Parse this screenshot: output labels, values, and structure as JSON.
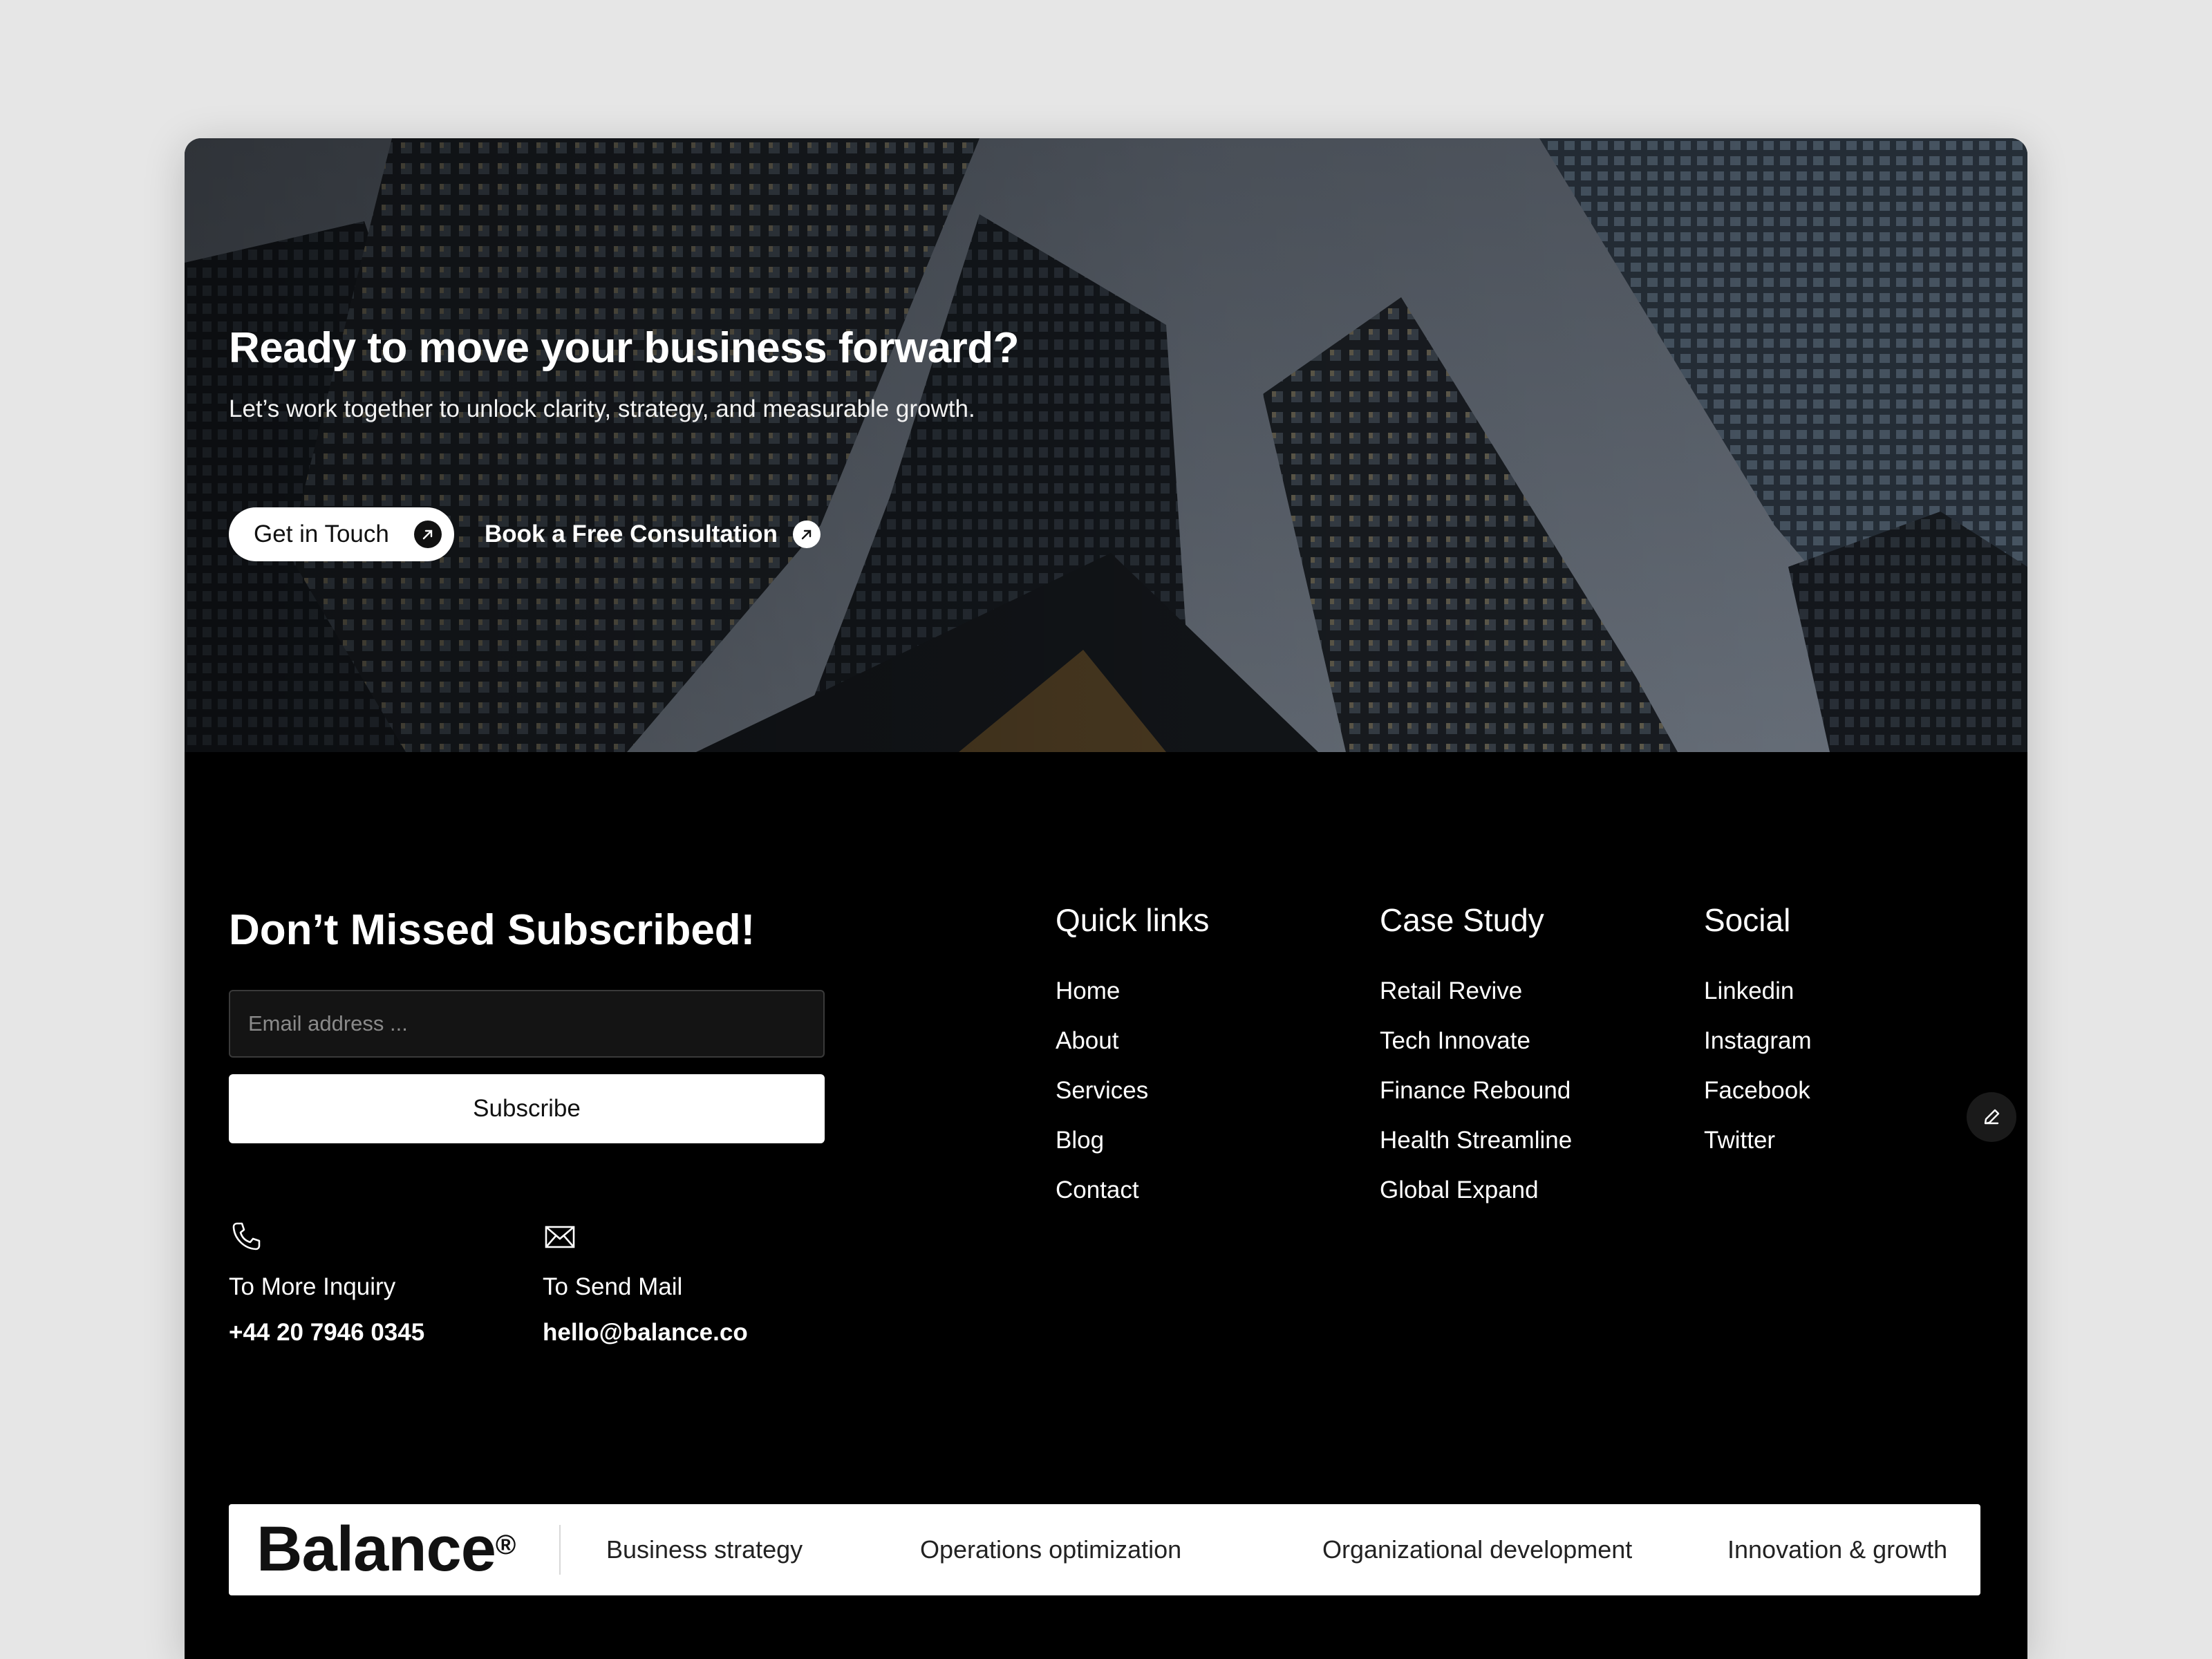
{
  "hero": {
    "title": "Ready to move your business forward?",
    "subtitle": "Let’s work together to unlock clarity, strategy, and measurable growth.",
    "primary_cta": "Get in Touch",
    "secondary_cta": "Book a Free Consultation"
  },
  "newsletter": {
    "title": "Don’t Missed Subscribed!",
    "email_placeholder": "Email address ...",
    "subscribe_label": "Subscribe"
  },
  "contact": {
    "phone": {
      "icon": "phone-icon",
      "label": "To More Inquiry",
      "value": "+44 20 7946 0345"
    },
    "mail": {
      "icon": "mail-icon",
      "label": "To Send Mail",
      "value": "hello@balance.co"
    }
  },
  "quick_links": {
    "title": "Quick links",
    "items": [
      "Home",
      "About",
      "Services",
      "Blog",
      "Contact"
    ]
  },
  "case_study": {
    "title": "Case Study",
    "items": [
      "Retail Revive",
      "Tech Innovate",
      "Finance Rebound",
      "Health Streamline",
      "Global Expand"
    ]
  },
  "social": {
    "title": "Social",
    "items": [
      "Linkedin",
      "Instagram",
      "Facebook",
      "Twitter"
    ]
  },
  "brand": {
    "logo": "Balance",
    "registered": "®",
    "tags": [
      "Business strategy",
      "Operations optimization",
      "Organizational development",
      "Innovation & growth"
    ]
  },
  "colors": {
    "page_bg": "#e6e6e6",
    "footer_bg": "#000000",
    "text": "#ffffff",
    "button_bg": "#ffffff"
  }
}
